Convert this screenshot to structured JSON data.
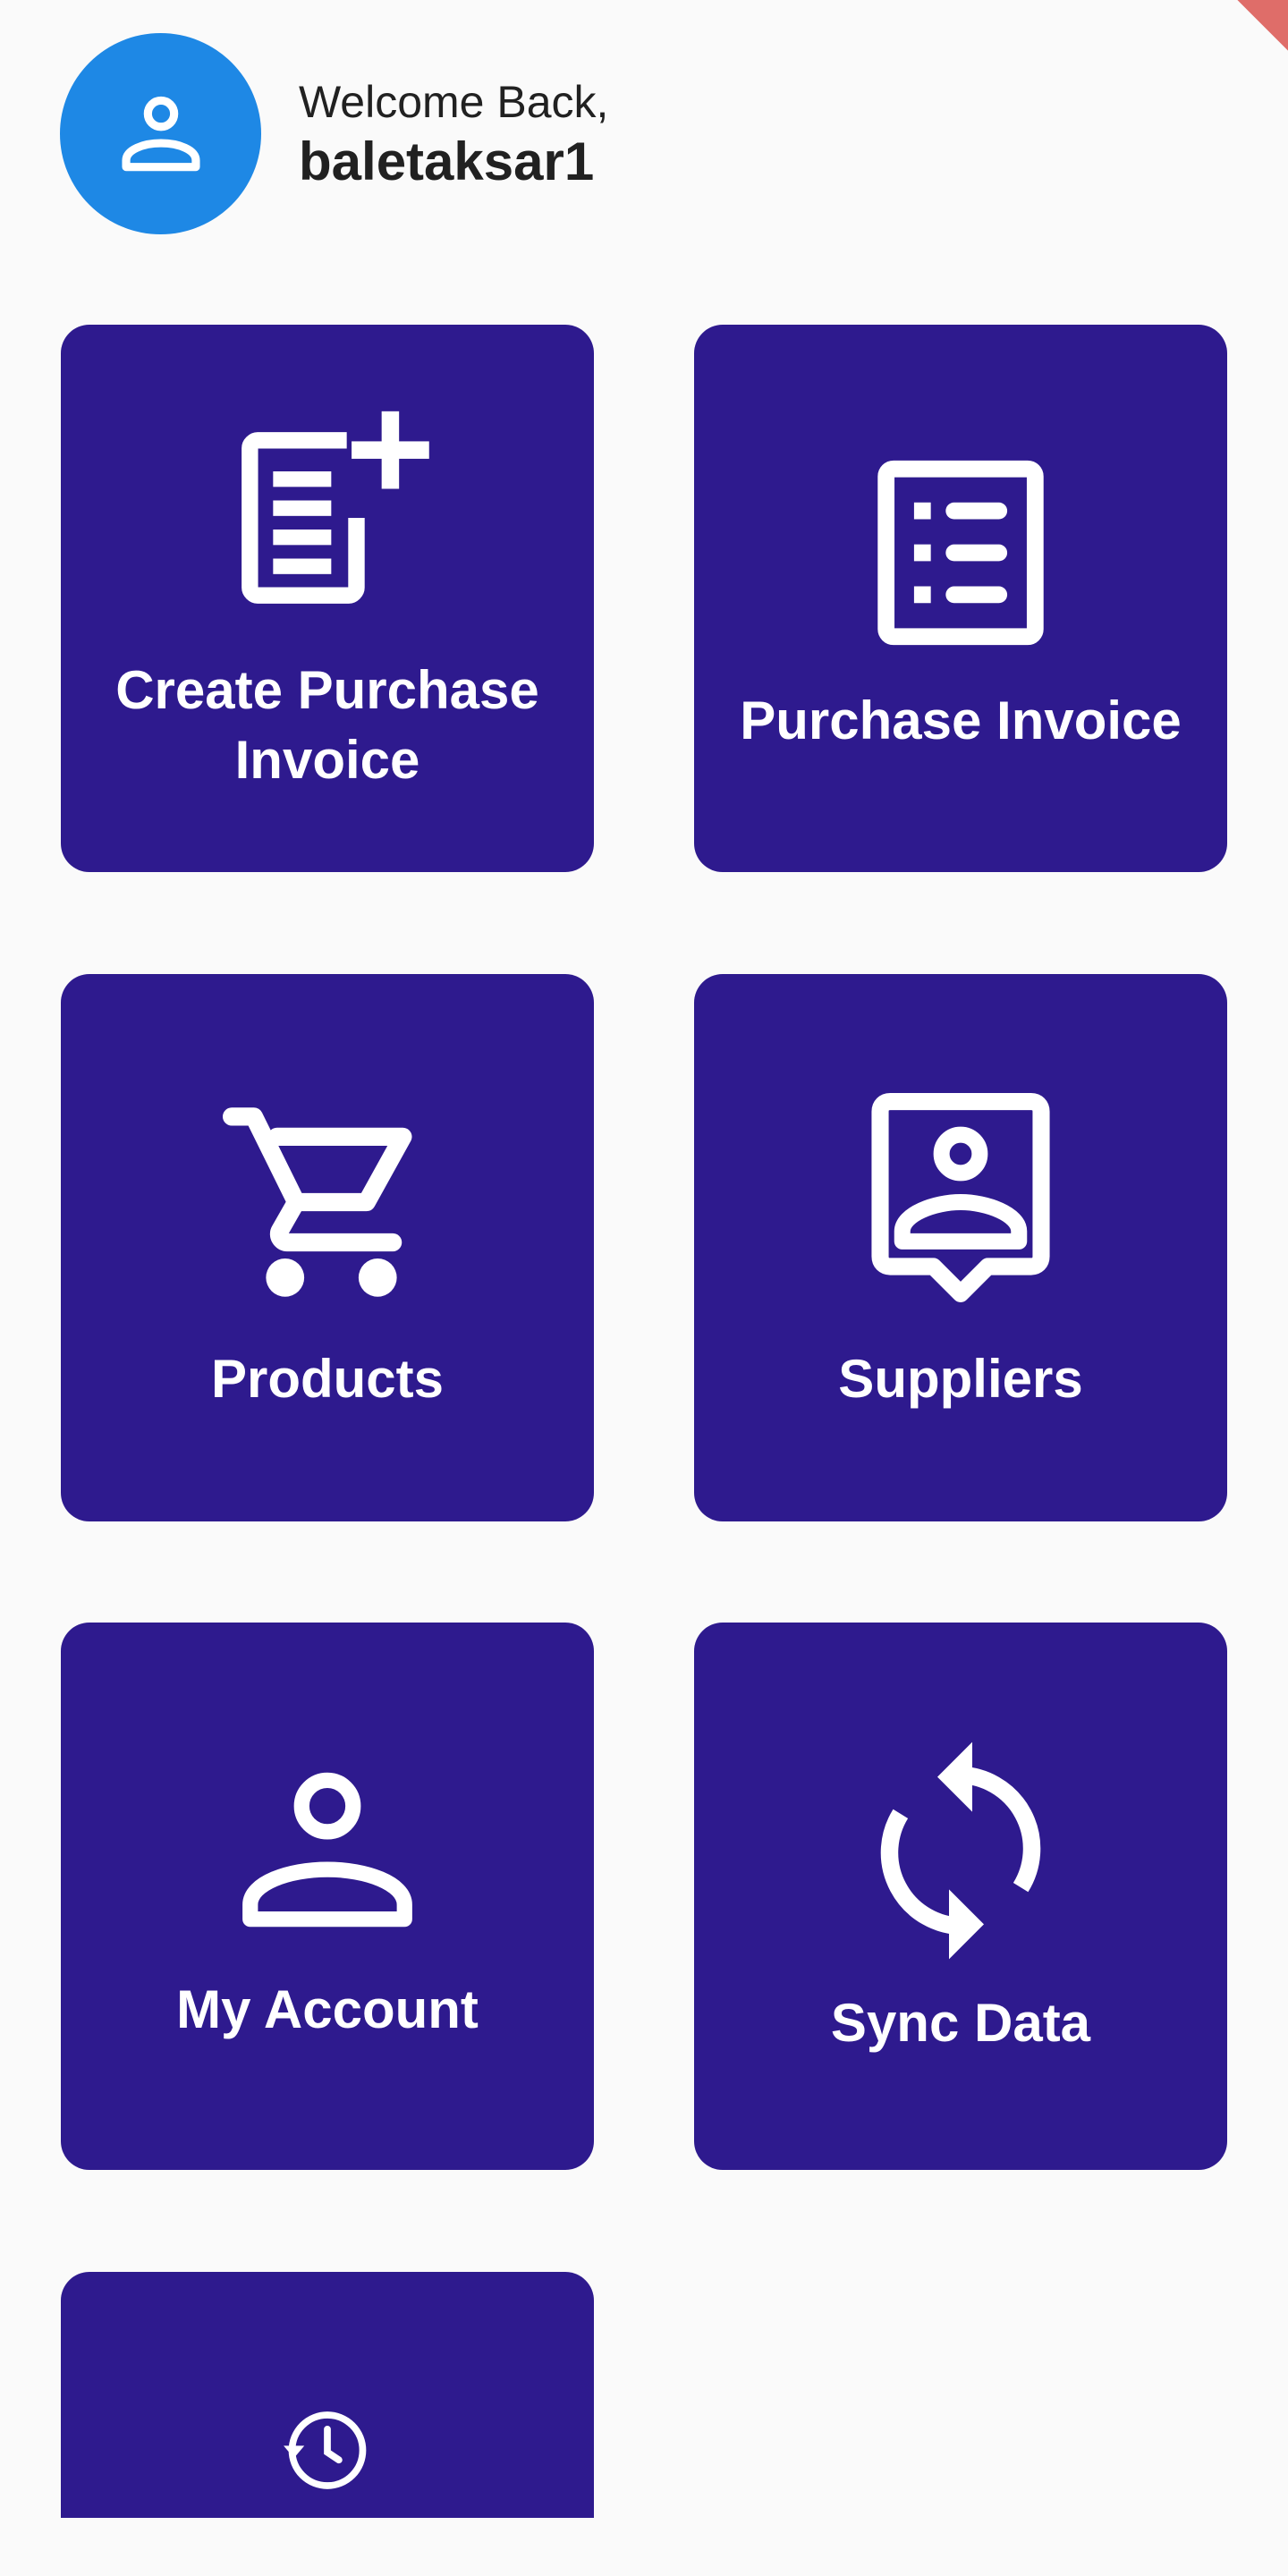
{
  "header": {
    "welcome": "Welcome Back,",
    "username": "baletaksar1",
    "avatar_icon": "person-icon",
    "avatar_color": "#1e88e5"
  },
  "theme": {
    "tile_color": "#2e1a8e",
    "background": "#fafafa"
  },
  "menu": [
    {
      "label": "Create Purchase Invoice",
      "icon": "add-document-icon"
    },
    {
      "label": "Purchase Invoice",
      "icon": "list-document-icon"
    },
    {
      "label": "Products",
      "icon": "shopping-cart-icon"
    },
    {
      "label": "Suppliers",
      "icon": "contact-card-icon"
    },
    {
      "label": "My Account",
      "icon": "person-icon"
    },
    {
      "label": "Sync Data",
      "icon": "sync-icon"
    },
    {
      "label": "",
      "icon": "history-icon"
    }
  ]
}
